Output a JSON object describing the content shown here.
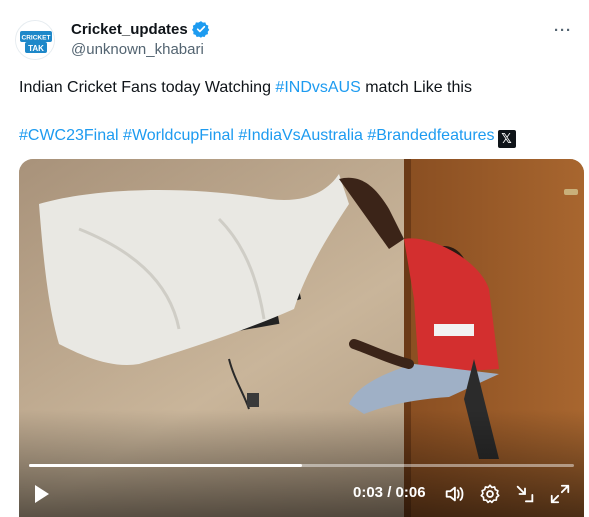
{
  "tweet": {
    "display_name": "Cricket_updates",
    "handle": "@unknown_khabari",
    "more_label": "···",
    "avatar_text_top": "CRICKET",
    "avatar_text_bottom": "TAK",
    "text_line1_prefix": "Indian Cricket Fans today Watching ",
    "text_line1_hashtag": "#INDvsAUS",
    "text_line1_suffix": " match Like this",
    "hashtags": [
      "#CWC23Final",
      "#WorldcupFinal",
      "#IndiaVsAustralia",
      "#Brandedfeatures"
    ],
    "x_badge": "𝕏"
  },
  "video": {
    "current_time": "0:03",
    "separator": "/",
    "duration": "0:06",
    "progress_fraction": 0.5
  },
  "colors": {
    "accent": "#1d9bf0",
    "text": "#0f1419",
    "muted": "#536471"
  },
  "icons": [
    "verified-icon",
    "more-icon",
    "play-icon",
    "volume-icon",
    "settings-icon",
    "minimize-icon",
    "fullscreen-icon"
  ]
}
